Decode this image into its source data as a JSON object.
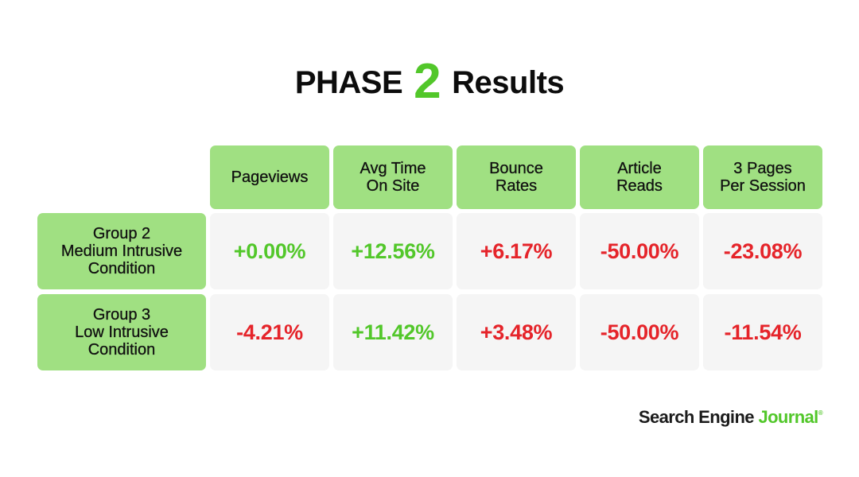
{
  "title": {
    "prefix": "PHASE",
    "number": "2",
    "suffix": "Results"
  },
  "colors": {
    "accent_green": "#52c72a",
    "header_green": "#a0e082",
    "negative_red": "#e5242a",
    "cell_gray": "#f5f5f5"
  },
  "chart_data": {
    "type": "table",
    "title": "PHASE 2 Results",
    "columns": [
      "Pageviews",
      "Avg Time On Site",
      "Bounce Rates",
      "Article Reads",
      "3 Pages Per Session"
    ],
    "column_lines": [
      [
        "Pageviews"
      ],
      [
        "Avg Time",
        "On Site"
      ],
      [
        "Bounce",
        "Rates"
      ],
      [
        "Article",
        "Reads"
      ],
      [
        "3 Pages",
        "Per Session"
      ]
    ],
    "rows": [
      {
        "label_lines": [
          "Group 2",
          "Medium Intrusive",
          "Condition"
        ],
        "values": [
          "+0.00%",
          "+12.56%",
          "+6.17%",
          "-50.00%",
          "-23.08%"
        ],
        "numeric": [
          0.0,
          12.56,
          6.17,
          -50.0,
          -23.08
        ],
        "colors": [
          "green",
          "green",
          "red",
          "red",
          "red"
        ]
      },
      {
        "label_lines": [
          "Group 3",
          "Low Intrusive",
          "Condition"
        ],
        "values": [
          "-4.21%",
          "+11.42%",
          "+3.48%",
          "-50.00%",
          "-11.54%"
        ],
        "numeric": [
          -4.21,
          11.42,
          3.48,
          -50.0,
          -11.54
        ],
        "colors": [
          "red",
          "green",
          "red",
          "red",
          "red"
        ]
      }
    ]
  },
  "brand": {
    "part1": "Search Engine",
    "part2": "Journal",
    "mark": "®"
  }
}
